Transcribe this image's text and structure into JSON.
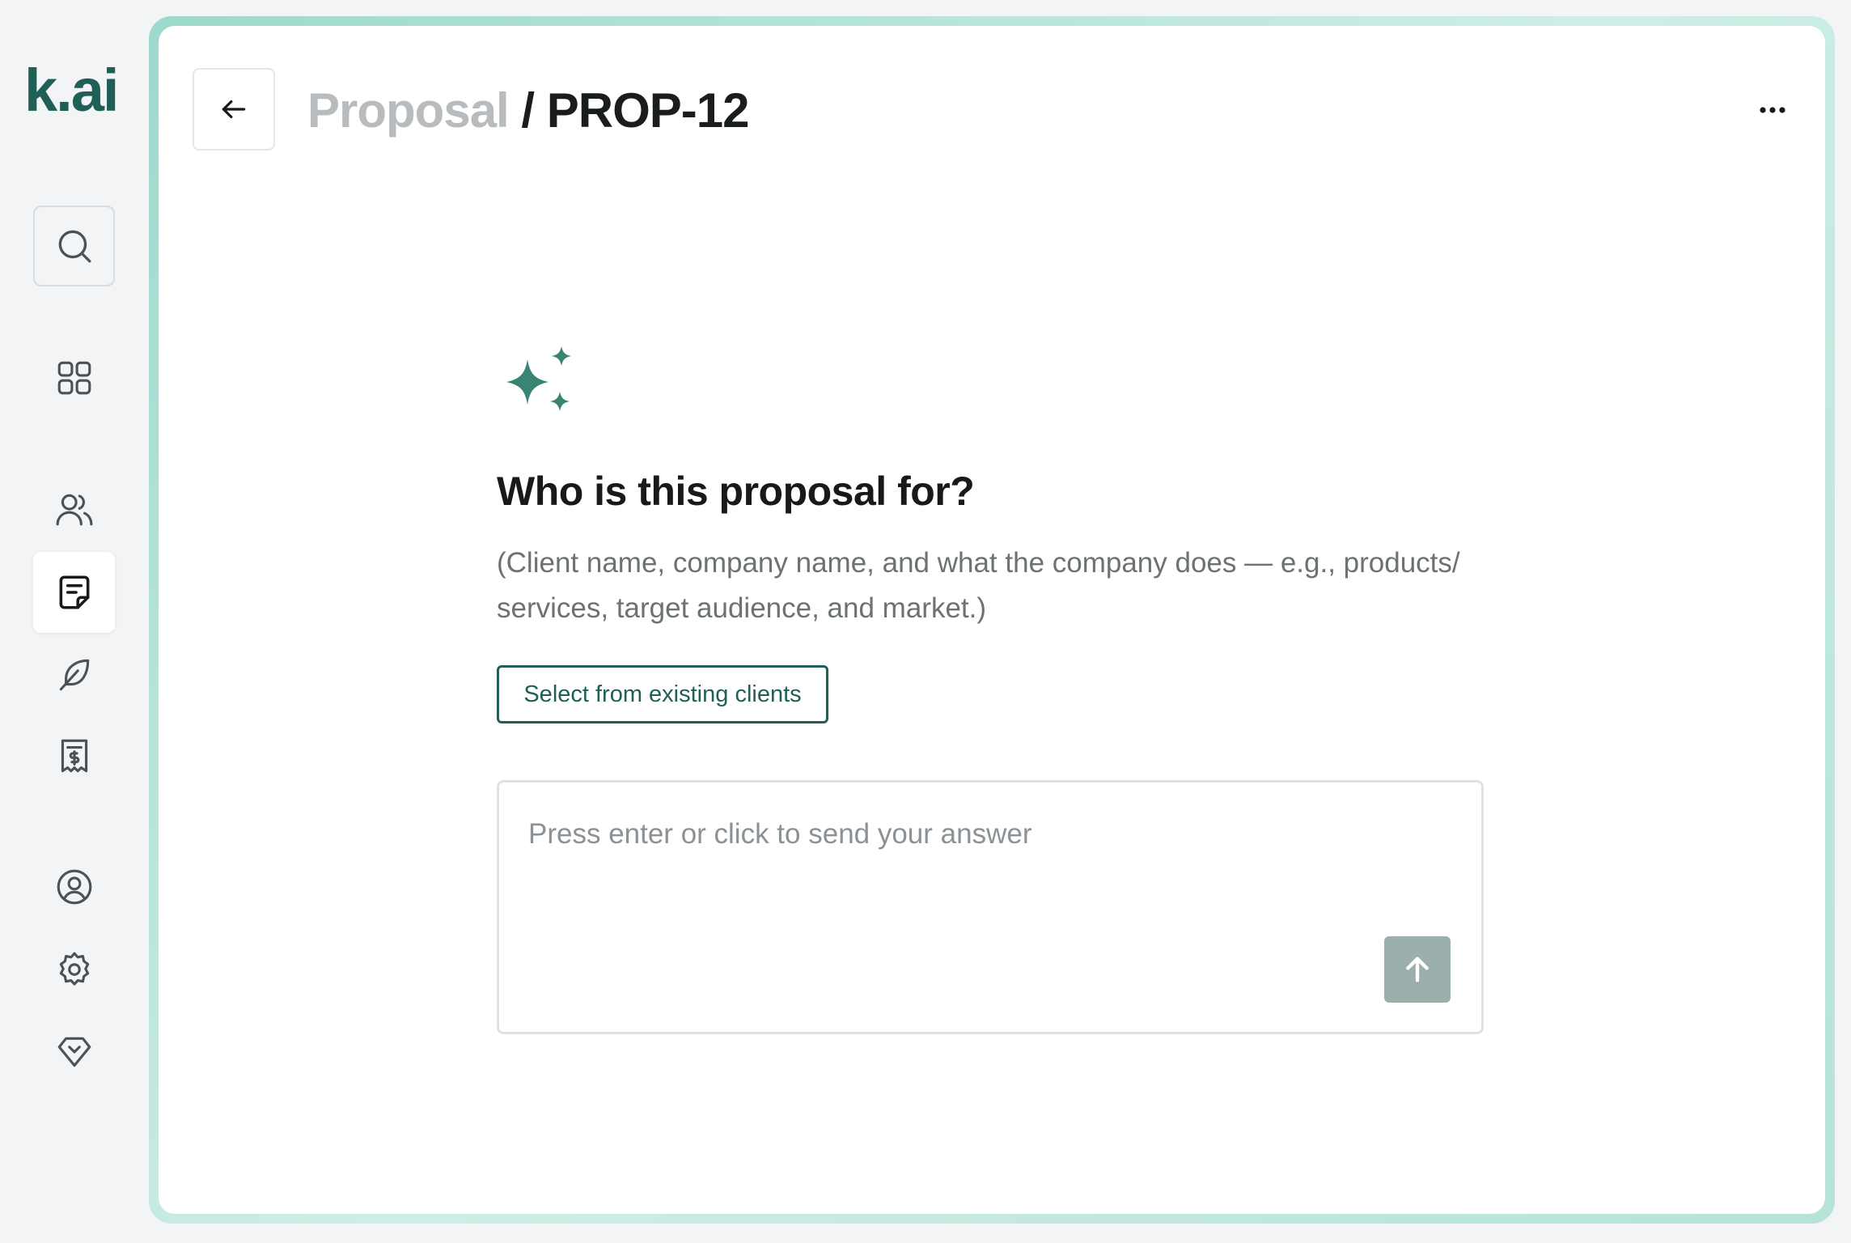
{
  "app": {
    "logo_text": "k.ai"
  },
  "sidebar": {
    "items": [
      {
        "name": "search",
        "icon": "search-icon"
      },
      {
        "name": "dashboard",
        "icon": "grid-icon"
      },
      {
        "name": "clients",
        "icon": "users-icon"
      },
      {
        "name": "proposals",
        "icon": "document-icon",
        "active": true
      },
      {
        "name": "content",
        "icon": "feather-icon"
      },
      {
        "name": "invoices",
        "icon": "receipt-icon"
      },
      {
        "name": "profile",
        "icon": "user-circle-icon"
      },
      {
        "name": "settings",
        "icon": "gear-icon"
      },
      {
        "name": "plan",
        "icon": "diamond-icon"
      }
    ]
  },
  "header": {
    "breadcrumb_parent": "Proposal",
    "breadcrumb_separator": " / ",
    "breadcrumb_current": "PROP-12"
  },
  "main": {
    "question": "Who is this proposal for?",
    "hint": "(Client name, company name, and what the company does — e.g., products/ services, target audience, and market.)",
    "select_button_label": "Select from existing clients",
    "answer_placeholder": "Press enter or click to send your answer"
  },
  "colors": {
    "brand": "#1f5f55",
    "accent_frame": "#9ed9cd",
    "send_button": "#9bb0ad"
  }
}
